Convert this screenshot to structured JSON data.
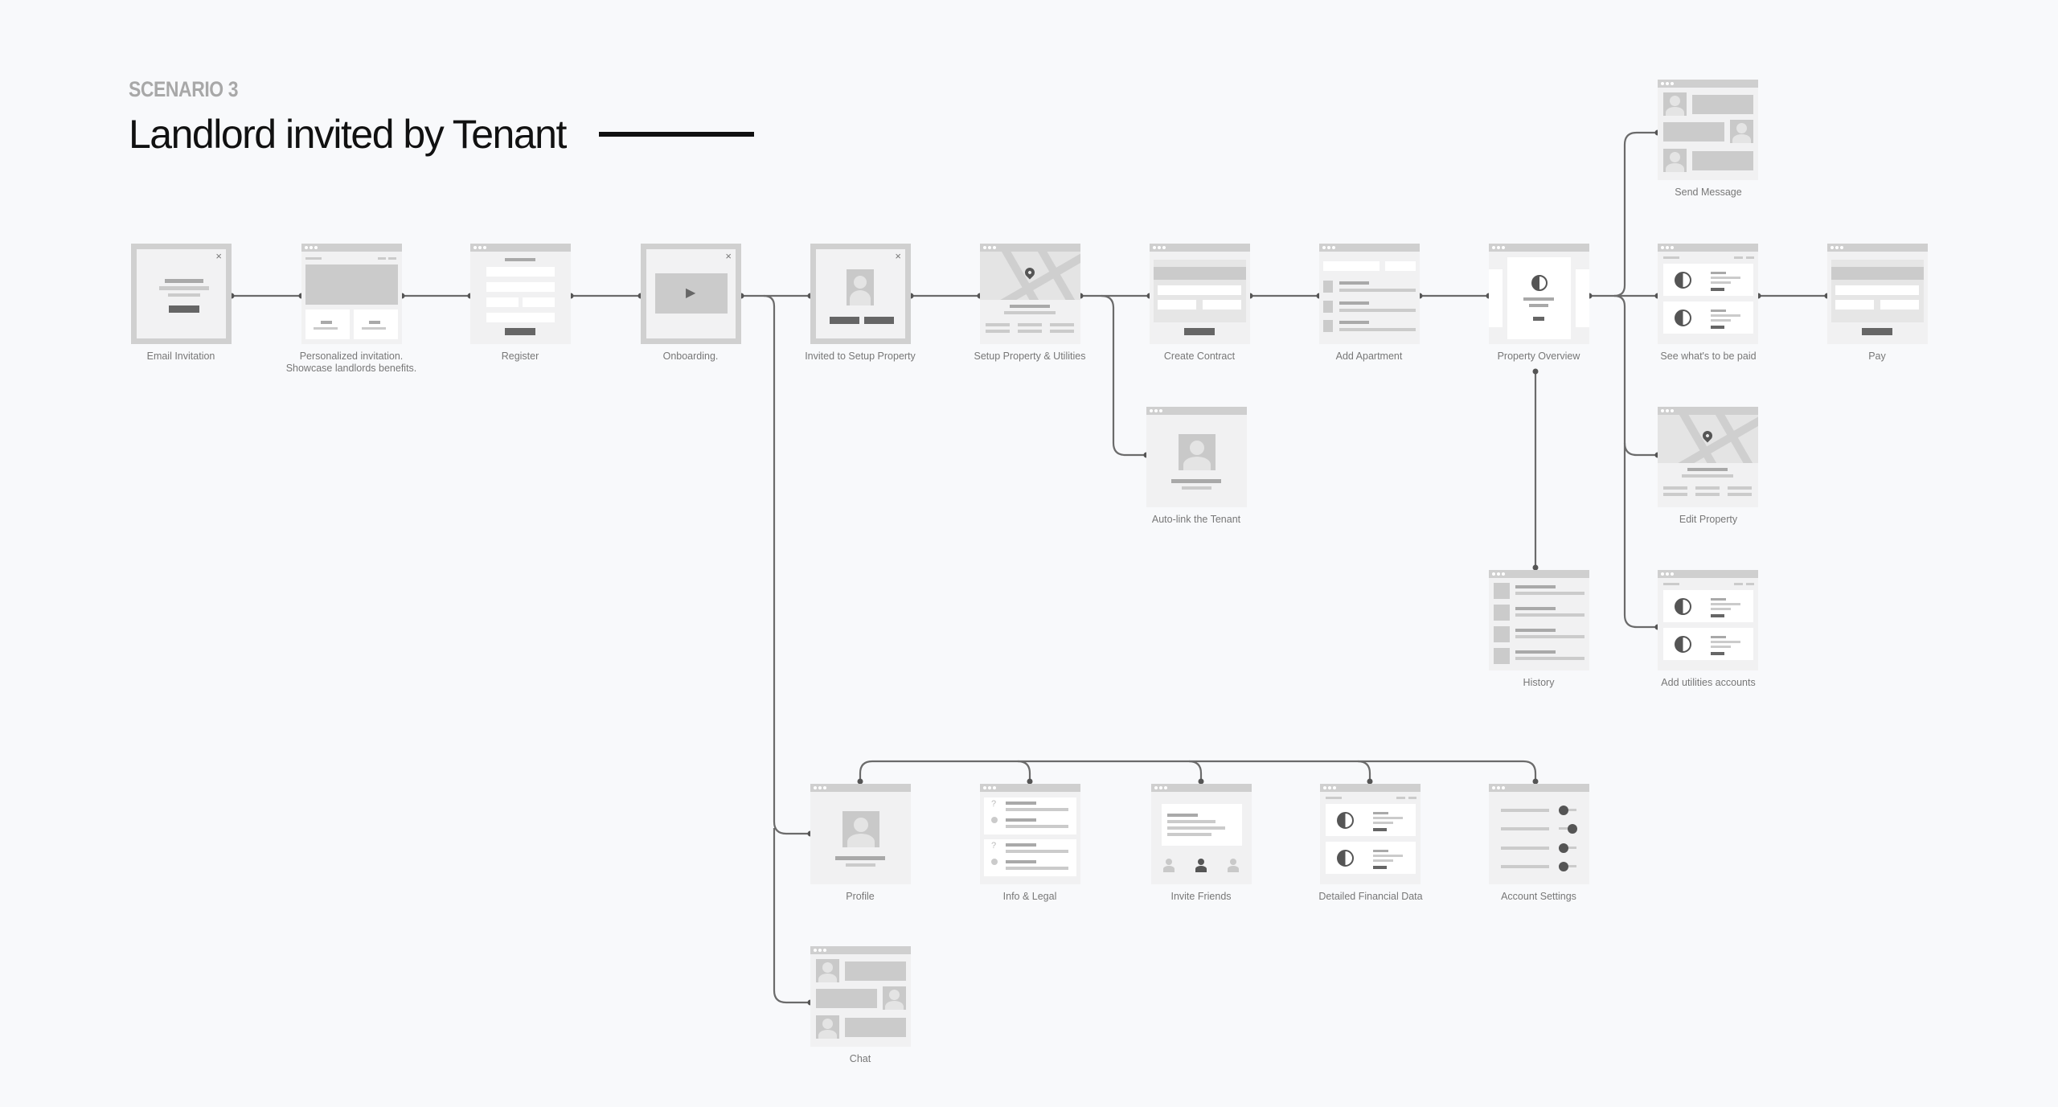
{
  "header": {
    "eyebrow": "SCENARIO 3",
    "title": "Landlord invited by Tenant"
  },
  "screens": {
    "email_invitation": {
      "label": "Email Invitation",
      "close_icon": "×"
    },
    "personalized_invitation": {
      "label": "Personalized invitation. Showcase landlords benefits."
    },
    "register": {
      "label": "Register"
    },
    "onboarding": {
      "label": "Onboarding.",
      "close_icon": "×",
      "play_icon": "▶"
    },
    "invited_setup": {
      "label": "Invited to Setup Property",
      "close_icon": "×"
    },
    "setup_property": {
      "label": "Setup Property & Utilities"
    },
    "create_contract": {
      "label": "Create Contract"
    },
    "add_apartment": {
      "label": "Add Apartment"
    },
    "property_overview": {
      "label": "Property Overview"
    },
    "see_paid": {
      "label": "See what's to be paid"
    },
    "pay": {
      "label": "Pay"
    },
    "send_message": {
      "label": "Send Message"
    },
    "auto_link": {
      "label": "Auto-link the Tenant"
    },
    "edit_property": {
      "label": "Edit Property"
    },
    "history": {
      "label": "History"
    },
    "add_utilities": {
      "label": "Add utilities accounts"
    },
    "profile": {
      "label": "Profile"
    },
    "info_legal": {
      "label": "Info & Legal",
      "question_icon": "?"
    },
    "invite_friends": {
      "label": "Invite Friends"
    },
    "financial_data": {
      "label": "Detailed Financial Data"
    },
    "account_settings": {
      "label": "Account Settings"
    },
    "chat": {
      "label": "Chat"
    }
  },
  "flow": [
    [
      "email_invitation",
      "personalized_invitation"
    ],
    [
      "personalized_invitation",
      "register"
    ],
    [
      "register",
      "onboarding"
    ],
    [
      "onboarding",
      "invited_setup"
    ],
    [
      "invited_setup",
      "setup_property"
    ],
    [
      "setup_property",
      "create_contract"
    ],
    [
      "setup_property",
      "auto_link"
    ],
    [
      "create_contract",
      "add_apartment"
    ],
    [
      "add_apartment",
      "property_overview"
    ],
    [
      "property_overview",
      "see_paid"
    ],
    [
      "property_overview",
      "send_message"
    ],
    [
      "property_overview",
      "edit_property"
    ],
    [
      "property_overview",
      "add_utilities"
    ],
    [
      "property_overview",
      "history"
    ],
    [
      "see_paid",
      "pay"
    ],
    [
      "onboarding",
      "profile"
    ],
    [
      "onboarding",
      "chat"
    ],
    [
      "onboarding",
      "info_legal"
    ],
    [
      "onboarding",
      "invite_friends"
    ],
    [
      "onboarding",
      "financial_data"
    ],
    [
      "onboarding",
      "account_settings"
    ]
  ],
  "colors": {
    "background": "#f8f9fb",
    "connector": "#6b6b6b",
    "wire_light": "#cbcbcb",
    "wire_dark": "#666666",
    "title": "#111111",
    "eyebrow": "#a8a8a8",
    "label": "#777777"
  }
}
